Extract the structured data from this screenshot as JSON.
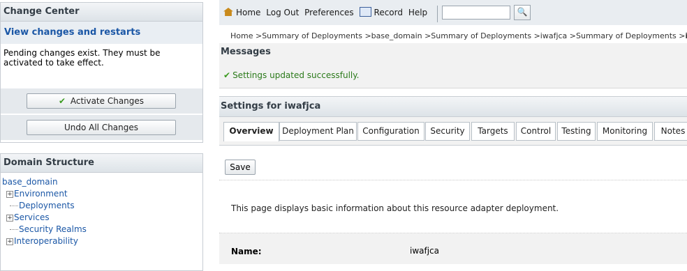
{
  "change_center": {
    "title": "Change Center",
    "link": "View changes and restarts",
    "pending": "Pending changes exist. They must be activated to take effect.",
    "activate_label": "Activate Changes",
    "undo_label": "Undo All Changes"
  },
  "domain_structure": {
    "title": "Domain Structure",
    "root": "base_domain",
    "items": [
      {
        "label": "Environment",
        "expandable": true
      },
      {
        "label": "Deployments",
        "expandable": false
      },
      {
        "label": "Services",
        "expandable": true
      },
      {
        "label": "Security Realms",
        "expandable": false
      },
      {
        "label": "Interoperability",
        "expandable": true
      }
    ]
  },
  "toolbar": {
    "home": "Home",
    "logout": "Log Out",
    "preferences": "Preferences",
    "record": "Record",
    "help": "Help",
    "search_value": "",
    "search_button": "🔍"
  },
  "breadcrumb": {
    "path": "Home >Summary of Deployments >base_domain >Summary of Deployments >iwafjca >Summary of Deployments >",
    "current": "iwafjca"
  },
  "messages": {
    "title": "Messages",
    "success": "Settings updated successfully."
  },
  "settings": {
    "title": "Settings for iwafjca",
    "tabs": [
      "Overview",
      "Deployment Plan",
      "Configuration",
      "Security",
      "Targets",
      "Control",
      "Testing",
      "Monitoring",
      "Notes"
    ],
    "save_label": "Save",
    "description": "This page displays basic information about this resource adapter deployment.",
    "name_label": "Name:",
    "name_value": "iwafjca"
  },
  "colors": {
    "link": "#1b57a6",
    "header_text": "#333d46",
    "success": "#2b7a1a"
  }
}
